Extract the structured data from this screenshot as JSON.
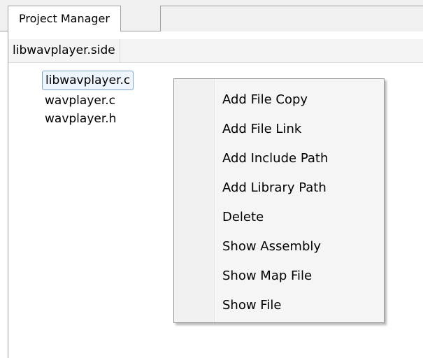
{
  "tabs": [
    {
      "label": "Project Manager"
    }
  ],
  "tree": {
    "header": "libwavplayer.side",
    "items": [
      {
        "label": "libwavplayer.c",
        "selected": true
      },
      {
        "label": "wavplayer.c",
        "selected": false
      },
      {
        "label": "wavplayer.h",
        "selected": false
      }
    ]
  },
  "context_menu": {
    "items": [
      {
        "label": "Add File Copy"
      },
      {
        "label": "Add File Link"
      },
      {
        "label": "Add Include Path"
      },
      {
        "label": "Add Library Path"
      },
      {
        "label": "Delete"
      },
      {
        "label": "Show Assembly"
      },
      {
        "label": "Show Map File"
      },
      {
        "label": "Show File"
      }
    ]
  },
  "colors": {
    "selection_fill": "#eef5fd",
    "selection_border": "#7da2ce",
    "menu_background": "#f5f5f5",
    "chrome_border": "#a0a0a0"
  }
}
